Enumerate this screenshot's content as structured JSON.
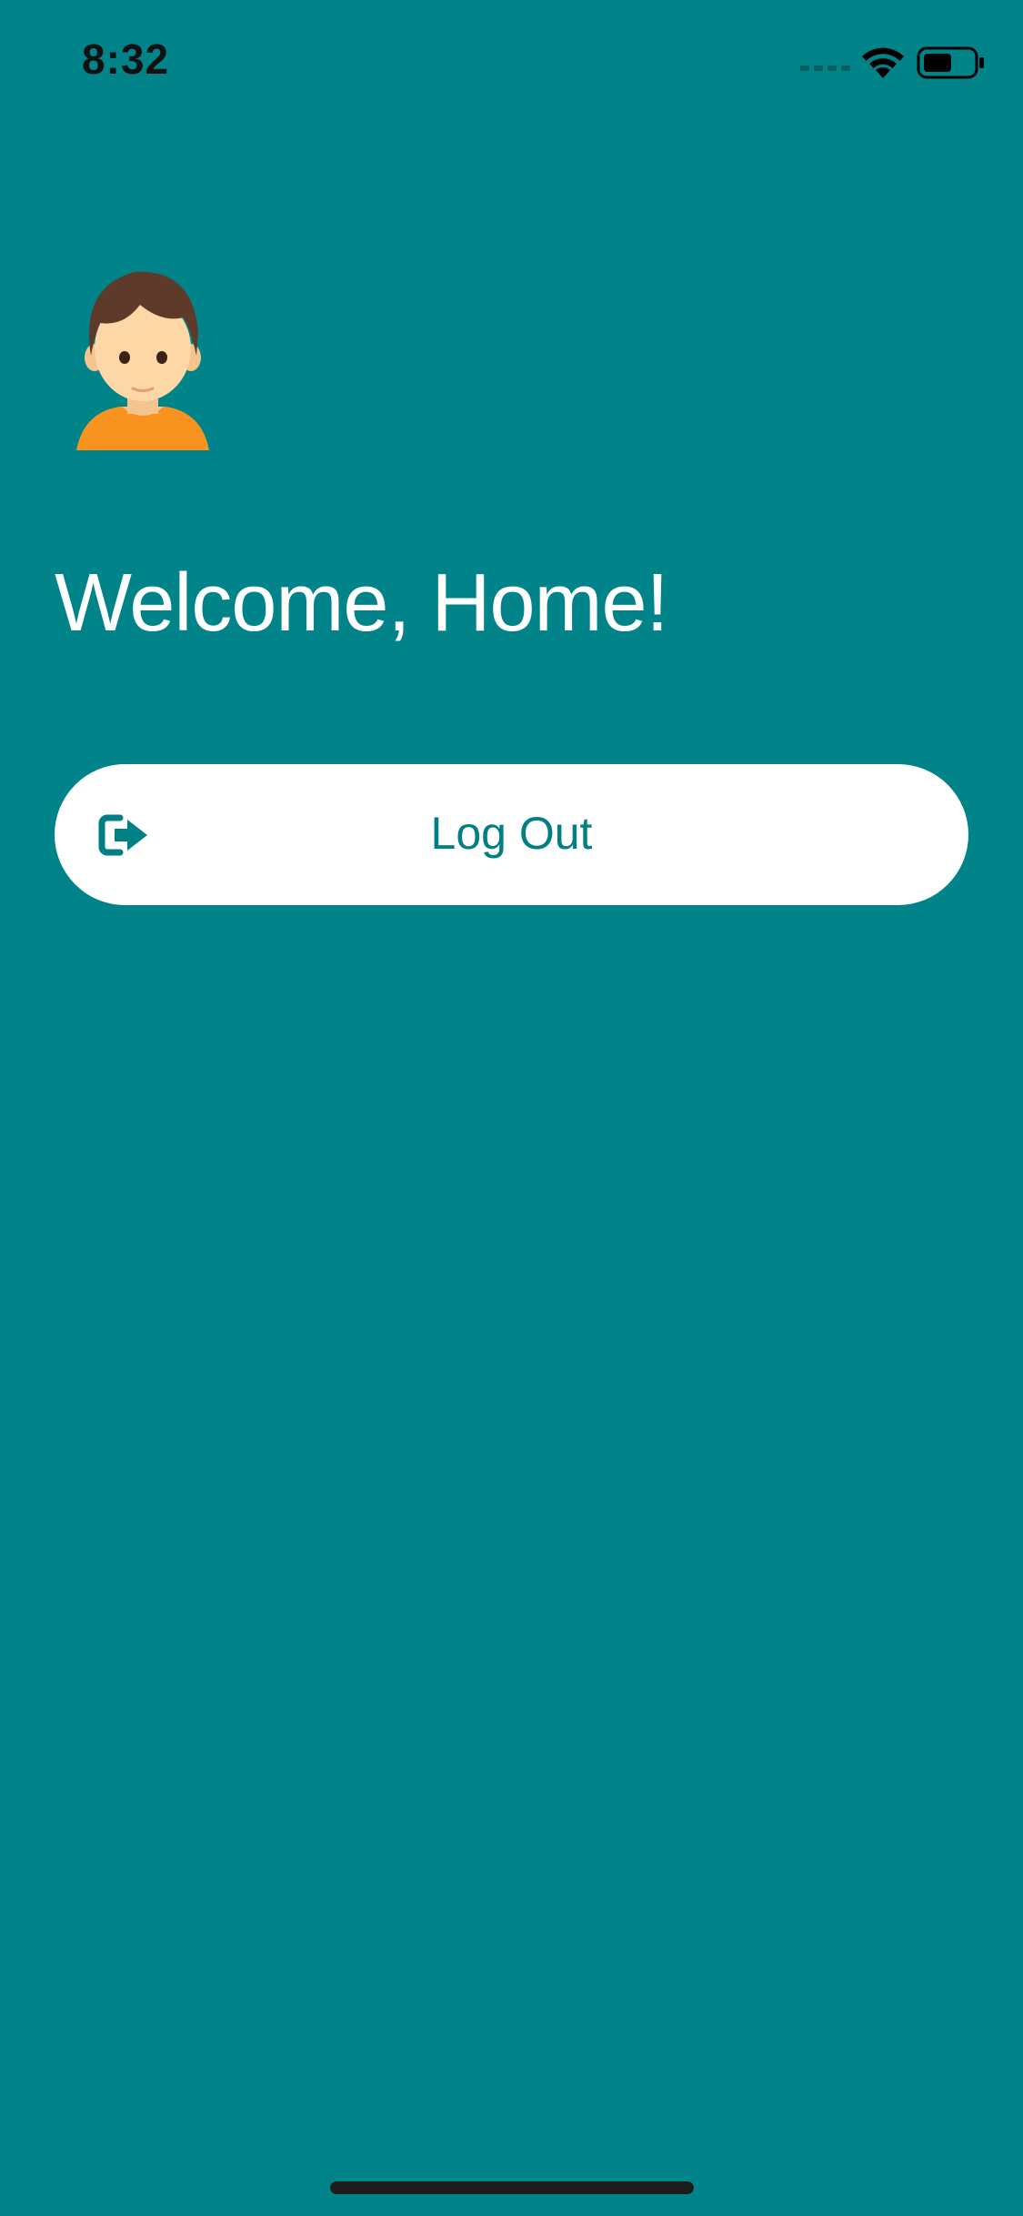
{
  "status_bar": {
    "time": "8:32",
    "icons": [
      "signal-icon",
      "wifi-icon",
      "battery-icon"
    ]
  },
  "home": {
    "avatar": "boy-avatar",
    "welcome_text": "Welcome, Home!",
    "logout_button": {
      "label": "Log Out",
      "icon": "logout-icon"
    }
  },
  "colors": {
    "background": "#008489",
    "button_background": "#ffffff",
    "accent": "#007f85",
    "avatar_hair": "#5d3a2a",
    "avatar_skin": "#fdd7a5",
    "avatar_shirt": "#f7931e"
  }
}
